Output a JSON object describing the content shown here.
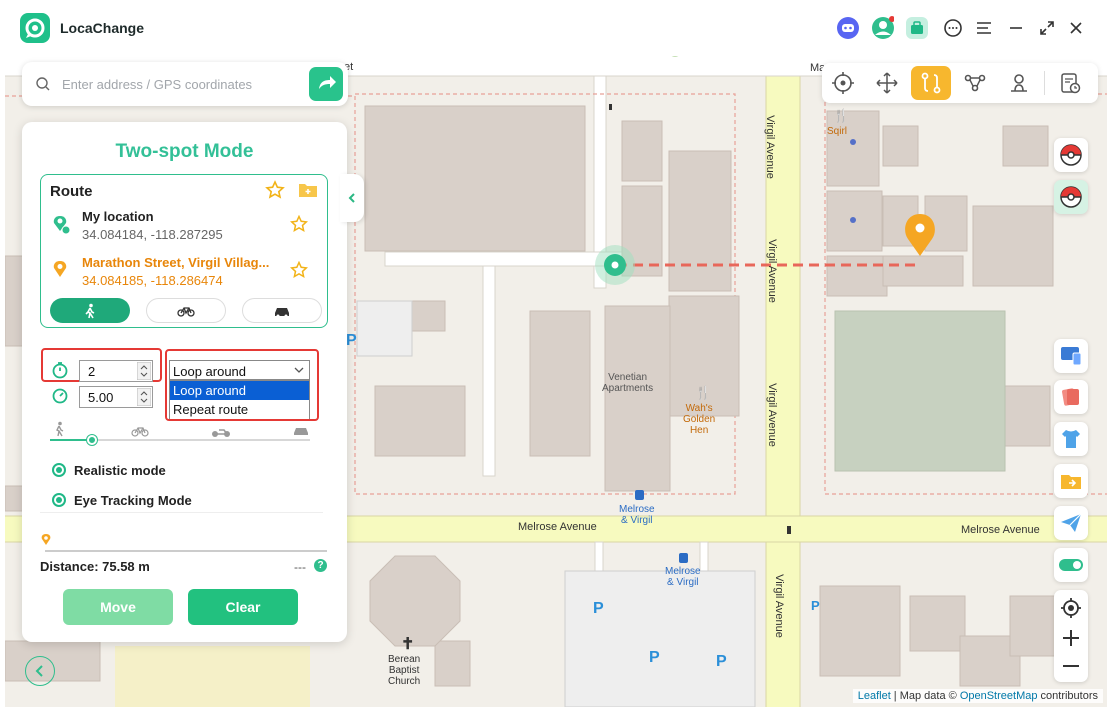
{
  "app": {
    "title": "LocaChange"
  },
  "search": {
    "placeholder": "Enter address / GPS coordinates"
  },
  "panel": {
    "title": "Two-spot Mode",
    "route_heading": "Route",
    "start": {
      "name": "My location",
      "coords": "34.084184, -118.287295"
    },
    "end": {
      "name": "Marathon Street, Virgil Villag...",
      "coords": "34.084185, -118.286474"
    },
    "repeat_count": "2",
    "speed": "5.00",
    "route_type": {
      "selected": "Loop around",
      "options": [
        "Loop around",
        "Repeat route"
      ],
      "highlighted": "Loop around"
    },
    "speed_slider_fraction": 0.16,
    "realistic_mode_label": "Realistic mode",
    "eye_tracking_label": "Eye Tracking Mode",
    "distance_label": "Distance: 75.58 m",
    "distance_right": "---",
    "move_label": "Move",
    "clear_label": "Clear"
  },
  "map": {
    "streets": {
      "melrose_left": "Melrose Avenue",
      "melrose_right": "Melrose Avenue",
      "virgil_1": "Virgil Avenue",
      "virgil_2": "Virgil Avenue",
      "virgil_3": "Virgil Avenue",
      "virgil_4": "Virgil Avenue",
      "top_et": "et",
      "top_ma": "Ma"
    },
    "pois": {
      "venetian": "Venetian\nApartments",
      "wahs": "Wah's\nGolden\nHen",
      "melrose_virgil_1": "Melrose\n& Virgil",
      "melrose_virgil_2": "Melrose\n& Virgil",
      "berean": "Berean\nBaptist\nChurch",
      "sqirl": "Sqirl"
    },
    "attribution": {
      "leaflet": "Leaflet",
      "sep": " | Map data © ",
      "osm": "OpenStreetMap",
      "contrib": " contributors"
    }
  },
  "colors": {
    "accent": "#2fbe8d",
    "orange": "#e8860a",
    "toolbar_active": "#f7b72e",
    "red_box": "#e53935",
    "route_line": "#e8675a"
  }
}
